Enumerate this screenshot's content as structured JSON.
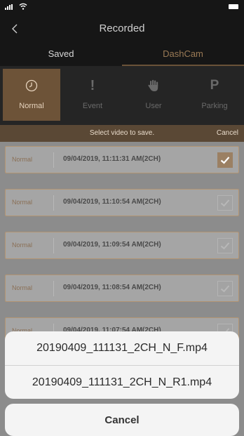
{
  "nav": {
    "title": "Recorded",
    "back_icon": "chevron-left-icon"
  },
  "tabs": [
    {
      "label": "Saved",
      "selected": false
    },
    {
      "label": "DashCam",
      "selected": true
    }
  ],
  "categories": [
    {
      "label": "Normal",
      "icon": "clock-icon",
      "selected": true
    },
    {
      "label": "Event",
      "icon": "exclamation-icon",
      "glyph": "!",
      "selected": false
    },
    {
      "label": "User",
      "icon": "hand-icon",
      "selected": false
    },
    {
      "label": "Parking",
      "icon": "parking-icon",
      "glyph": "P",
      "selected": false
    }
  ],
  "instruction": {
    "text": "Select video to save.",
    "cancel_label": "Cancel"
  },
  "videos": [
    {
      "type": "Normal",
      "datetime": "09/04/2019, 11:11:31 AM(2CH)",
      "checked": true
    },
    {
      "type": "Normal",
      "datetime": "09/04/2019, 11:10:54 AM(2CH)",
      "checked": false
    },
    {
      "type": "Normal",
      "datetime": "09/04/2019, 11:09:54 AM(2CH)",
      "checked": false
    },
    {
      "type": "Normal",
      "datetime": "09/04/2019, 11:08:54 AM(2CH)",
      "checked": false
    },
    {
      "type": "Normal",
      "datetime": "09/04/2019, 11:07:54 AM(2CH)",
      "checked": false
    }
  ],
  "action_sheet": {
    "options": [
      "20190409_111131_2CH_N_F.mp4",
      "20190409_111131_2CH_N_R1.mp4"
    ],
    "cancel_label": "Cancel"
  },
  "colors": {
    "accent": "#6d5338",
    "accent_text": "#9a7a55",
    "background_dark": "#161616",
    "sheet_background": "#f4f4f4"
  }
}
